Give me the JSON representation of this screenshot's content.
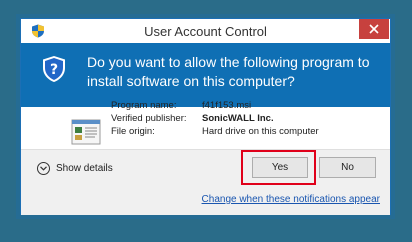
{
  "window": {
    "title": "User Account Control",
    "close_icon": "close-icon"
  },
  "banner": {
    "question": "Do you want to allow the following program to install software on this computer?",
    "icon": "uac-shield-icon"
  },
  "program": {
    "icon": "program-icon",
    "rows": [
      {
        "label": "Program name:",
        "value": "f41f153.msi"
      },
      {
        "label": "Verified publisher:",
        "value": "SonicWALL Inc."
      },
      {
        "label": "File origin:",
        "value": "Hard drive on this computer"
      }
    ]
  },
  "footer": {
    "details_label": "Show details",
    "yes_label": "Yes",
    "no_label": "No",
    "link_label": "Change when these notifications appear"
  },
  "colors": {
    "background": "#2a6c89",
    "banner": "#0f6fb4",
    "highlight": "#e0001a",
    "link": "#1a56b0"
  }
}
